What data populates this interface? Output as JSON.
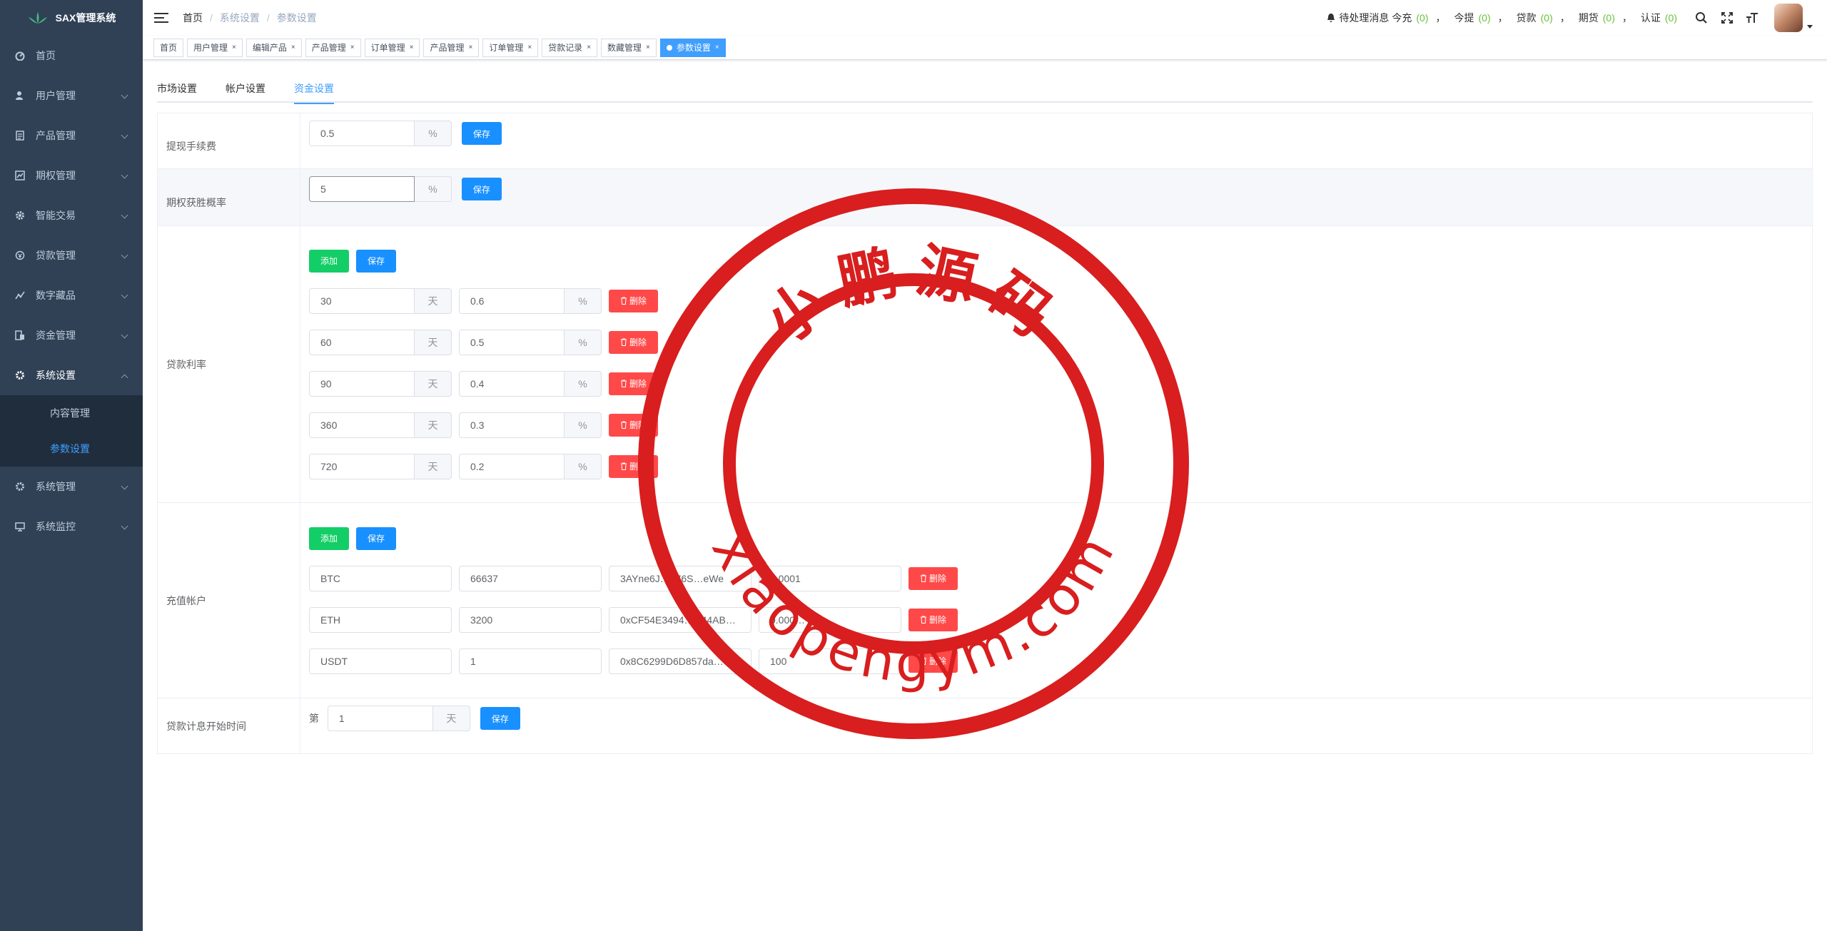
{
  "app": {
    "title": "SAX管理系统"
  },
  "sidebar": {
    "items": [
      {
        "label": "首页",
        "icon": "dashboard-icon"
      },
      {
        "label": "用户管理",
        "icon": "user-icon"
      },
      {
        "label": "产品管理",
        "icon": "document-icon"
      },
      {
        "label": "期权管理",
        "icon": "chart-icon"
      },
      {
        "label": "智能交易",
        "icon": "gear-icon"
      },
      {
        "label": "贷款管理",
        "icon": "money-icon"
      },
      {
        "label": "数字藏品",
        "icon": "trend-icon"
      },
      {
        "label": "资金管理",
        "icon": "finance-icon"
      },
      {
        "label": "系统设置",
        "icon": "settings-icon"
      },
      {
        "label": "系统管理",
        "icon": "settings-icon"
      },
      {
        "label": "系统监控",
        "icon": "monitor-icon"
      }
    ],
    "submenu": [
      {
        "label": "内容管理"
      },
      {
        "label": "参数设置"
      }
    ]
  },
  "breadcrumb": [
    "首页",
    "系统设置",
    "参数设置"
  ],
  "navbar": {
    "pending_label": "待处理消息",
    "items": [
      {
        "label": "今充",
        "count": "(0)"
      },
      {
        "label": "今提",
        "count": "(0)"
      },
      {
        "label": "贷款",
        "count": "(0)"
      },
      {
        "label": "期货",
        "count": "(0)"
      },
      {
        "label": "认证",
        "count": "(0)"
      }
    ],
    "comma": "，"
  },
  "tags": [
    "首页",
    "用户管理",
    "编辑产品",
    "产品管理",
    "订单管理",
    "产品管理",
    "订单管理",
    "贷款记录",
    "数藏管理",
    "参数设置"
  ],
  "tabs": [
    "市场设置",
    "帐户设置",
    "资金设置"
  ],
  "buttons": {
    "save": "保存",
    "add": "添加",
    "delete": "删除"
  },
  "form": {
    "withdraw_fee": {
      "label": "提现手续费",
      "value": "0.5",
      "unit": "%"
    },
    "option_win_rate": {
      "label": "期权获胜概率",
      "value": "5",
      "unit": "%"
    },
    "loan_rate": {
      "label": "贷款利率",
      "day_unit": "天",
      "pct_unit": "%",
      "rows": [
        {
          "days": "30",
          "rate": "0.6"
        },
        {
          "days": "60",
          "rate": "0.5"
        },
        {
          "days": "90",
          "rate": "0.4"
        },
        {
          "days": "360",
          "rate": "0.3"
        },
        {
          "days": "720",
          "rate": "0.2"
        }
      ]
    },
    "recharge": {
      "label": "充值帐户",
      "rows": [
        {
          "coin": "BTC",
          "price": "66637",
          "address": "3AYne6J…976S…eWe",
          "min": "0.0001"
        },
        {
          "coin": "ETH",
          "price": "3200",
          "address": "0xCF54E3494…D44AB…",
          "min": "0.000…"
        },
        {
          "coin": "USDT",
          "price": "1",
          "address": "0x8C6299D6D857da…",
          "min": "100"
        }
      ]
    },
    "loan_start": {
      "label": "贷款计息开始时间",
      "prefix": "第",
      "value": "1",
      "unit": "天"
    }
  },
  "watermark": {
    "top": "小鹏源码",
    "bottom": "xiaopengym.com",
    "color": "#d81e1e"
  }
}
